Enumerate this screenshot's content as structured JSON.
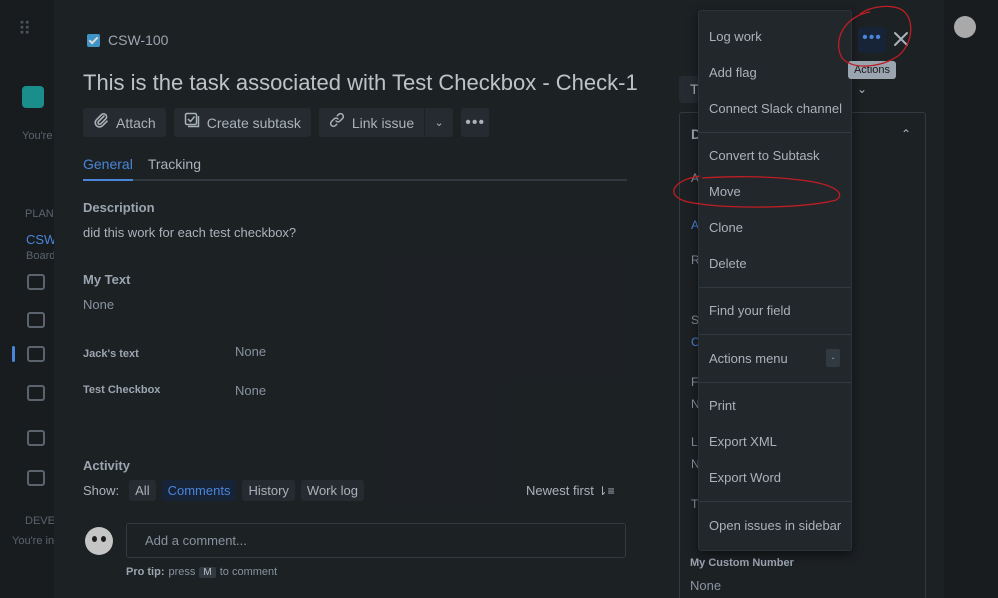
{
  "background": {
    "sidebar_texts": [
      "You're",
      "PLAN",
      "CSW",
      "Board",
      "DEVE",
      "You're in"
    ]
  },
  "issue": {
    "key": "CSW-100",
    "title": "This is the task associated with Test Checkbox - Check-1"
  },
  "toolbar": {
    "attach": "Attach",
    "create_subtask": "Create subtask",
    "link_issue": "Link issue"
  },
  "tabs": [
    "General",
    "Tracking"
  ],
  "description": {
    "heading": "Description",
    "text": "did this work for each test checkbox?"
  },
  "fields": {
    "my_text_label": "My Text",
    "my_text_value": "None",
    "jacks_text_label": "Jack's text",
    "jacks_text_value": "None",
    "test_checkbox_label": "Test Checkbox",
    "test_checkbox_value": "None"
  },
  "activity": {
    "heading": "Activity",
    "show_label": "Show:",
    "filters": [
      "All",
      "Comments",
      "History",
      "Work log"
    ],
    "sort": "Newest first",
    "comment_placeholder": "Add a comment...",
    "protip_prefix": "Pro tip:",
    "protip_press": "press",
    "protip_key": "M",
    "protip_suffix": "to comment"
  },
  "right_panel": {
    "status_fragment": "T",
    "details_fragment": "D",
    "side_fragments": [
      "A",
      "A",
      "R",
      "S",
      "C",
      "F",
      "N",
      "L",
      "N",
      "T"
    ],
    "custom_number_label": "My Custom Number",
    "custom_number_value": "None"
  },
  "menu": {
    "items": [
      "Log work",
      "Add flag",
      "Connect Slack channel",
      "Convert to Subtask",
      "Move",
      "Clone",
      "Delete",
      "Find your field",
      "Actions menu",
      "Print",
      "Export XML",
      "Export Word",
      "Open issues in sidebar"
    ],
    "actions_menu_shortcut": "."
  },
  "actions_tooltip": "Actions",
  "colors": {
    "accent": "#579dff",
    "annotation": "#e0242b"
  },
  "icons": [
    "grid-icon",
    "checkbox-icon",
    "attach-icon",
    "subtask-icon",
    "link-icon",
    "chevron-down-icon",
    "more-icon",
    "close-icon",
    "sort-icon"
  ]
}
